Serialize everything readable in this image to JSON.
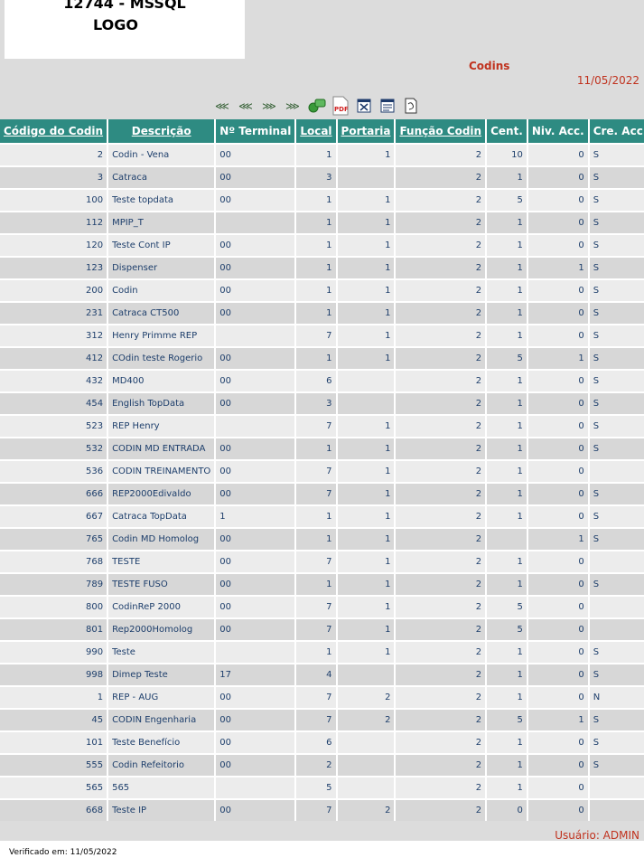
{
  "logo": {
    "line1": "12744 - MSSQL",
    "line2": "LOGO"
  },
  "report": {
    "title": "Codins",
    "date": "11/05/2022"
  },
  "toolbar": {
    "first_label": "⋘",
    "prev_label": "⋘",
    "next_label": "⋙",
    "last_label": "⋙",
    "pdf_label": "PDF",
    "icons": [
      "first-page-icon",
      "previous-page-icon",
      "next-page-icon",
      "last-page-icon",
      "search-icon",
      "pdf-icon",
      "excel-icon",
      "word-icon",
      "print-icon"
    ]
  },
  "table": {
    "headers": [
      "Código do Codin",
      "Descrição",
      "Nº Terminal",
      "Local",
      "Portaria",
      "Função Codin",
      "Cent.",
      "Niv. Acc.",
      "Cre. Acc."
    ],
    "rows": [
      [
        "2",
        "Codin - Vena",
        "00",
        "1",
        "1",
        "2",
        "10",
        "0",
        "S"
      ],
      [
        "3",
        "Catraca",
        "00",
        "3",
        "",
        "2",
        "1",
        "0",
        "S"
      ],
      [
        "100",
        "Teste topdata",
        "00",
        "1",
        "1",
        "2",
        "5",
        "0",
        "S"
      ],
      [
        "112",
        "MPIP_T",
        "",
        "1",
        "1",
        "2",
        "1",
        "0",
        "S"
      ],
      [
        "120",
        "Teste Cont IP",
        "00",
        "1",
        "1",
        "2",
        "1",
        "0",
        "S"
      ],
      [
        "123",
        "Dispenser",
        "00",
        "1",
        "1",
        "2",
        "1",
        "1",
        "S"
      ],
      [
        "200",
        "Codin",
        "00",
        "1",
        "1",
        "2",
        "1",
        "0",
        "S"
      ],
      [
        "231",
        "Catraca CT500",
        "00",
        "1",
        "1",
        "2",
        "1",
        "0",
        "S"
      ],
      [
        "312",
        "Henry Primme REP",
        "",
        "7",
        "1",
        "2",
        "1",
        "0",
        "S"
      ],
      [
        "412",
        "COdin teste Rogerio",
        "00",
        "1",
        "1",
        "2",
        "5",
        "1",
        "S"
      ],
      [
        "432",
        "MD400",
        "00",
        "6",
        "",
        "2",
        "1",
        "0",
        "S"
      ],
      [
        "454",
        "English TopData",
        "00",
        "3",
        "",
        "2",
        "1",
        "0",
        "S"
      ],
      [
        "523",
        "REP Henry",
        "",
        "7",
        "1",
        "2",
        "1",
        "0",
        "S"
      ],
      [
        "532",
        "CODIN MD ENTRADA",
        "00",
        "1",
        "1",
        "2",
        "1",
        "0",
        "S"
      ],
      [
        "536",
        "CODIN TREINAMENTO",
        "00",
        "7",
        "1",
        "2",
        "1",
        "0",
        ""
      ],
      [
        "666",
        "REP2000Edivaldo",
        "00",
        "7",
        "1",
        "2",
        "1",
        "0",
        "S"
      ],
      [
        "667",
        "Catraca TopData",
        "1",
        "1",
        "1",
        "2",
        "1",
        "0",
        "S"
      ],
      [
        "765",
        "Codin MD Homolog",
        "00",
        "1",
        "1",
        "2",
        "",
        "1",
        "S"
      ],
      [
        "768",
        "TESTE",
        "00",
        "7",
        "1",
        "2",
        "1",
        "0",
        ""
      ],
      [
        "789",
        "TESTE FUSO",
        "00",
        "1",
        "1",
        "2",
        "1",
        "0",
        "S"
      ],
      [
        "800",
        "CodinReP 2000",
        "00",
        "7",
        "1",
        "2",
        "5",
        "0",
        ""
      ],
      [
        "801",
        "Rep2000Homolog",
        "00",
        "7",
        "1",
        "2",
        "5",
        "0",
        ""
      ],
      [
        "990",
        "Teste",
        "",
        "1",
        "1",
        "2",
        "1",
        "0",
        "S"
      ],
      [
        "998",
        "Dimep Teste",
        "17",
        "4",
        "",
        "2",
        "1",
        "0",
        "S"
      ],
      [
        "1",
        "REP - AUG",
        "00",
        "7",
        "2",
        "2",
        "1",
        "0",
        "N"
      ],
      [
        "45",
        "CODIN Engenharia",
        "00",
        "7",
        "2",
        "2",
        "5",
        "1",
        "S"
      ],
      [
        "101",
        "Teste Benefício",
        "00",
        "6",
        "",
        "2",
        "1",
        "0",
        "S"
      ],
      [
        "555",
        "Codin Refeitorio",
        "00",
        "2",
        "",
        "2",
        "1",
        "0",
        "S"
      ],
      [
        "565",
        "565",
        "",
        "5",
        "",
        "2",
        "1",
        "0",
        ""
      ],
      [
        "668",
        "Teste IP",
        "00",
        "7",
        "2",
        "2",
        "0",
        "0",
        ""
      ]
    ]
  },
  "footer": {
    "user": "Usuário: ADMIN",
    "verified": "Verificado em: 11/05/2022"
  }
}
